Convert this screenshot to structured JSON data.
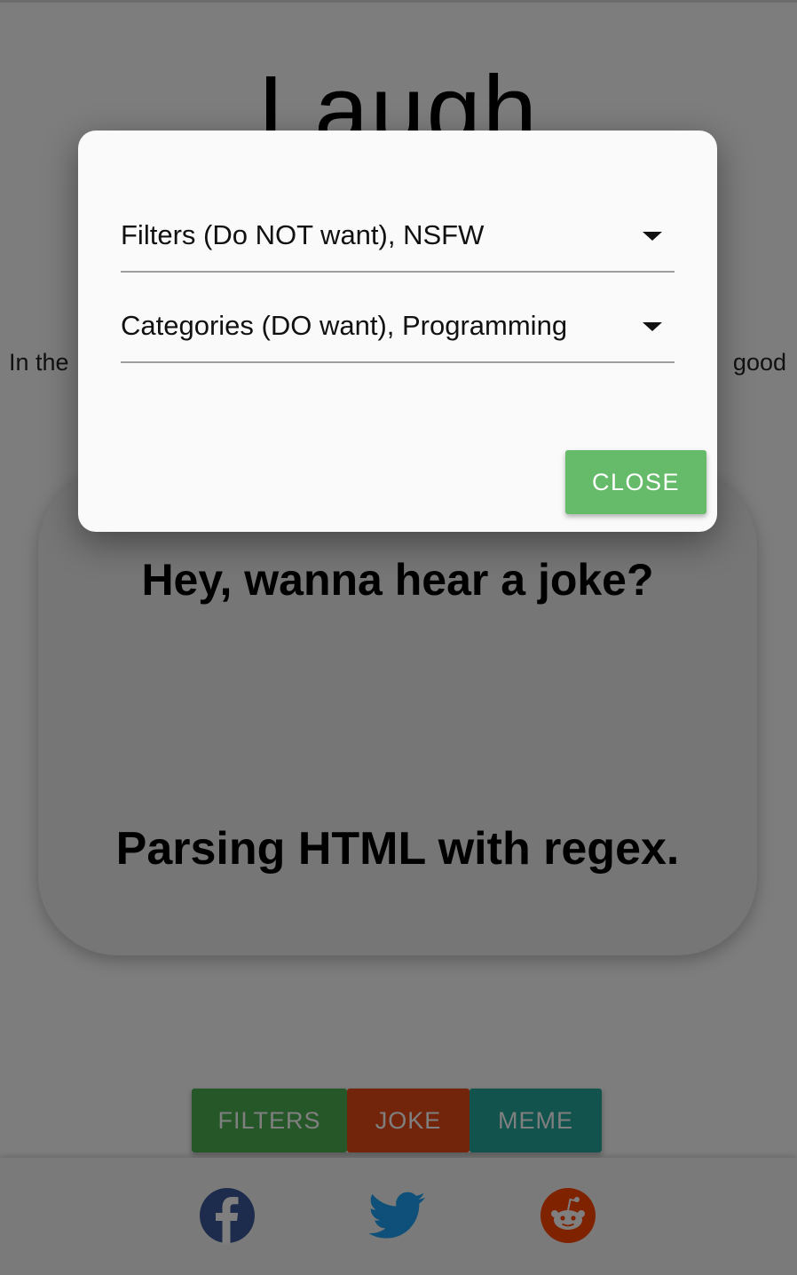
{
  "app": {
    "title": "Laugh"
  },
  "intro": {
    "left_fragment": "In the",
    "right_fragment": "good"
  },
  "joke": {
    "setup": "Hey, wanna hear a joke?",
    "punchline": "Parsing HTML with regex."
  },
  "actions": {
    "filters_label": "FILTERS",
    "joke_label": "JOKE",
    "meme_label": "MEME"
  },
  "social": {
    "icons": [
      "facebook-icon",
      "twitter-icon",
      "reddit-icon"
    ]
  },
  "dialog": {
    "filters_select_value": "Filters (Do NOT want), NSFW",
    "categories_select_value": "Categories (DO want), Programming",
    "close_label": "CLOSE"
  },
  "colors": {
    "filters_green": "#4caf50",
    "joke_orange": "#e64a19",
    "meme_teal": "#26a69a",
    "close_green": "#66bb6a",
    "facebook_blue": "#3b5998",
    "twitter_blue": "#1da1f2",
    "reddit_orange": "#ff4500"
  }
}
